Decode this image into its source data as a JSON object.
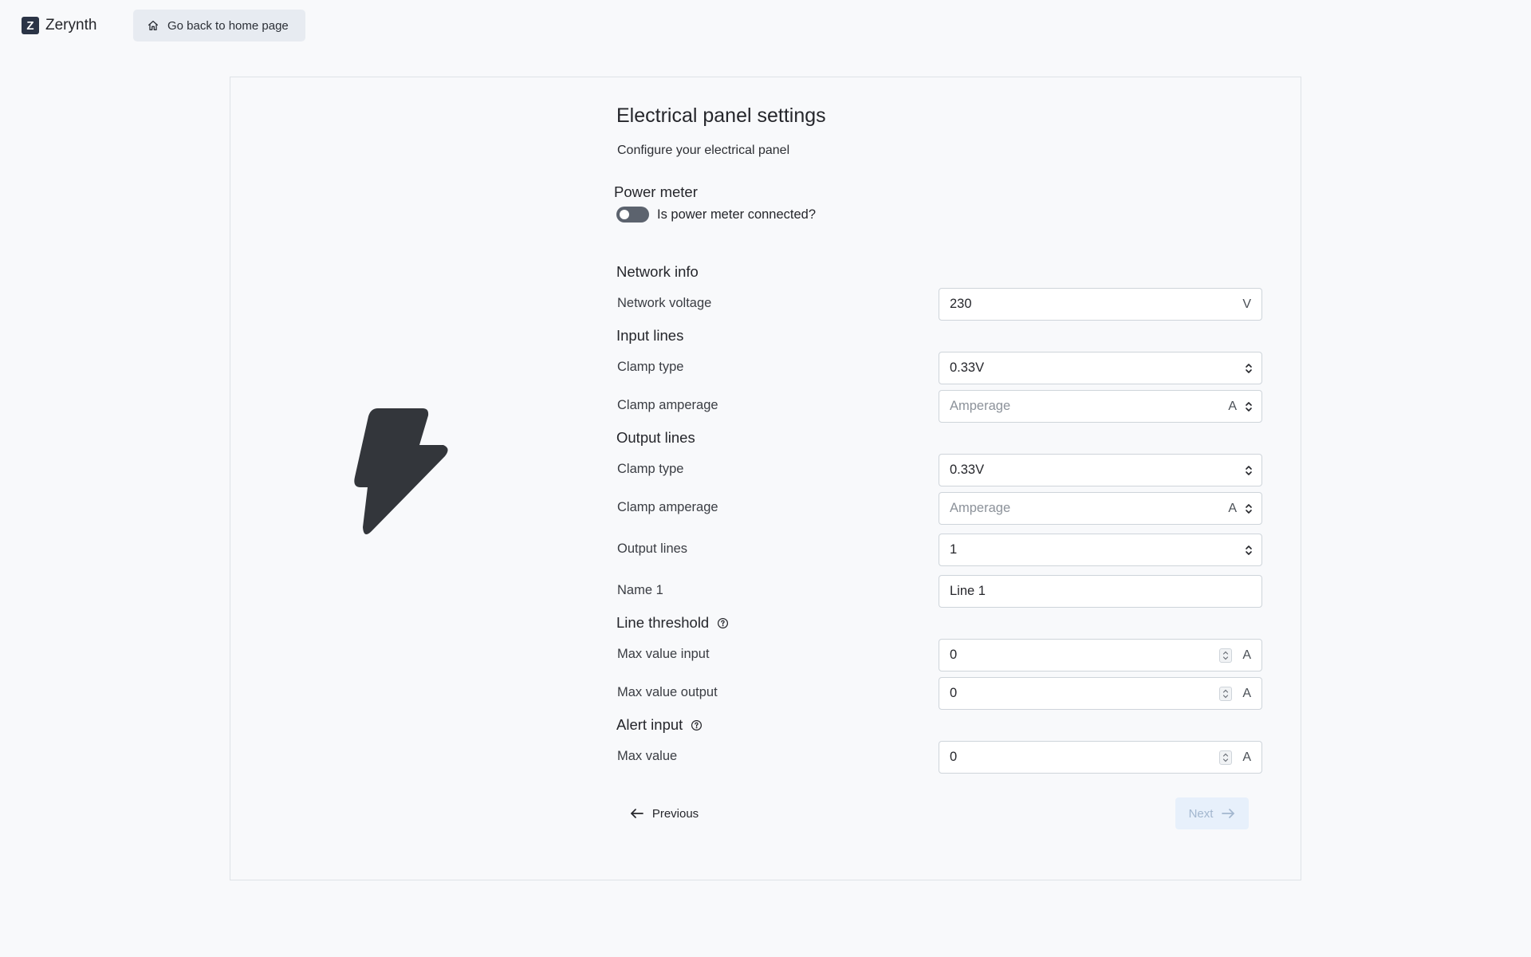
{
  "header": {
    "brand": "Zerynth",
    "logo_letter": "Z",
    "back_button_label": "Go back to home page"
  },
  "form": {
    "title": "Electrical panel settings",
    "subtitle": "Configure your electrical panel",
    "power_meter": {
      "heading": "Power meter",
      "toggle_label": "Is power meter connected?",
      "toggle_on": false
    },
    "network_info": {
      "heading": "Network info",
      "voltage_label": "Network voltage",
      "voltage_value": "230",
      "voltage_unit": "V"
    },
    "input_lines": {
      "heading": "Input lines",
      "clamp_type_label": "Clamp type",
      "clamp_type_value": "0.33V",
      "clamp_amperage_label": "Clamp amperage",
      "clamp_amperage_placeholder": "Amperage",
      "clamp_amperage_unit": "A"
    },
    "output_lines": {
      "heading": "Output lines",
      "clamp_type_label": "Clamp type",
      "clamp_type_value": "0.33V",
      "clamp_amperage_label": "Clamp amperage",
      "clamp_amperage_placeholder": "Amperage",
      "clamp_amperage_unit": "A",
      "count_label": "Output lines",
      "count_value": "1",
      "name_label": "Name 1",
      "name_value": "Line 1"
    },
    "line_threshold": {
      "heading": "Line threshold",
      "max_input_label": "Max value input",
      "max_input_value": "0",
      "max_output_label": "Max value output",
      "max_output_value": "0",
      "unit": "A"
    },
    "alert_input": {
      "heading": "Alert input",
      "max_label": "Max value",
      "max_value": "0",
      "unit": "A"
    }
  },
  "footer": {
    "previous_label": "Previous",
    "next_label": "Next"
  },
  "colors": {
    "background": "#f8f9fb",
    "brand_dark": "#2b3446",
    "bolt": "#33363b",
    "next_disabled_bg": "#e7f0fb"
  }
}
